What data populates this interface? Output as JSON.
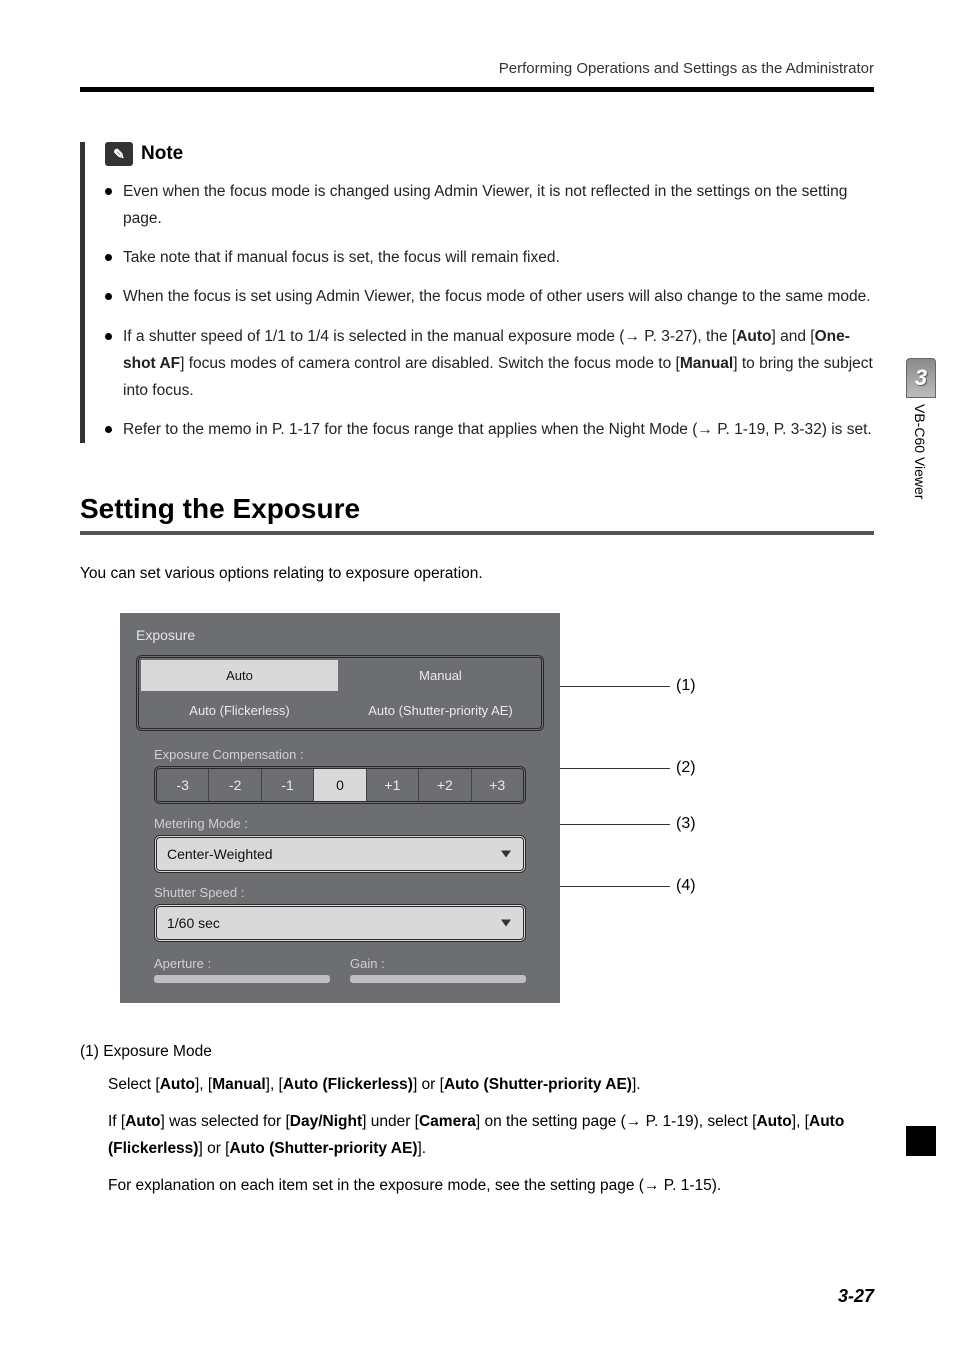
{
  "header": {
    "running_title": "Performing Operations and Settings as the Administrator"
  },
  "note": {
    "icon_glyph": "✎",
    "title": "Note",
    "items": [
      {
        "text": "Even when the focus mode is changed using Admin Viewer, it is not reflected in the settings on the setting page."
      },
      {
        "text": "Take note that if manual focus is set, the focus will remain fixed."
      },
      {
        "text": "When the focus is set using Admin Viewer, the focus mode of other users will also change to the same mode."
      },
      {
        "html": "If a shutter speed of 1/1 to 1/4 is selected in the manual exposure mode (→ P. 3-27), the [<b>Auto</b>] and [<b>One-shot AF</b>] focus modes of camera control are disabled. Switch the focus mode to [<b>Manual</b>] to bring the subject into focus."
      },
      {
        "text": "Refer to the memo in P. 1-17 for the focus range that applies when the Night Mode (→ P. 1-19, P. 3-32) is set."
      }
    ]
  },
  "section": {
    "heading": "Setting the Exposure",
    "intro": "You can set various options relating to exposure operation."
  },
  "panel": {
    "title": "Exposure",
    "modes": {
      "auto": "Auto",
      "manual": "Manual",
      "flickerless": "Auto (Flickerless)",
      "shutter_ae": "Auto (Shutter-priority AE)"
    },
    "exposure_comp": {
      "label": "Exposure Compensation :",
      "values": [
        "-3",
        "-2",
        "-1",
        "0",
        "+1",
        "+2",
        "+3"
      ],
      "active": "0"
    },
    "metering": {
      "label": "Metering Mode :",
      "value": "Center-Weighted"
    },
    "shutter": {
      "label": "Shutter Speed :",
      "value": "1/60 sec"
    },
    "aperture": {
      "label": "Aperture :"
    },
    "gain": {
      "label": "Gain :"
    }
  },
  "callouts": {
    "c1": "(1)",
    "c2": "(2)",
    "c3": "(3)",
    "c4": "(4)"
  },
  "definitions": {
    "num": "(1)  Exposure Mode",
    "p1_html": "Select [<b>Auto</b>], [<b>Manual</b>], [<b>Auto (Flickerless)</b>] or [<b>Auto (Shutter-priority AE)</b>].",
    "p2_html": "If [<b>Auto</b>] was selected for [<b>Day/Night</b>] under [<b>Camera</b>] on the setting page (→ P. 1-19), select [<b>Auto</b>], [<b>Auto (Flickerless)</b>] or [<b>Auto (Shutter-priority AE)</b>].",
    "p3": "For explanation on each item set in the exposure mode, see the setting page (→ P. 1-15)."
  },
  "sidebar": {
    "chapter_number": "3",
    "chapter_title": "VB-C60 Viewer"
  },
  "footer": {
    "page_number": "3-27"
  }
}
